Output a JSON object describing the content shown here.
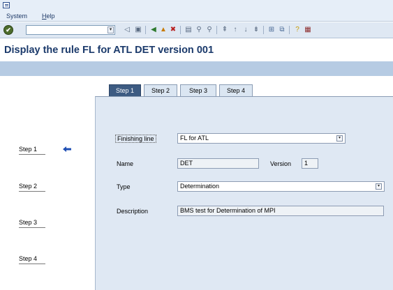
{
  "menu": {
    "items": [
      {
        "label": "System",
        "underline": ""
      },
      {
        "label": "elp",
        "underline": "H"
      }
    ]
  },
  "toolbar": {
    "enter_icon": "check-icon",
    "command_value": "",
    "icons": [
      "dropdown-icon",
      "back-small-icon",
      "save-icon",
      "back-icon",
      "exit-icon",
      "cancel-icon",
      "print-icon",
      "find-icon",
      "find-next-icon",
      "first-page-icon",
      "previous-page-icon",
      "next-page-icon",
      "last-page-icon",
      "create-session-icon",
      "shortcut-icon",
      "help-icon",
      "layout-icon"
    ]
  },
  "title": "Display the rule FL for ATL DET version 001",
  "steps_nav": [
    "Step 1",
    "Step 2",
    "Step 3",
    "Step 4"
  ],
  "current_step_indicator": "arrow-left-icon",
  "tabs": [
    {
      "label": "Step 1",
      "active": true
    },
    {
      "label": "Step 2",
      "active": false
    },
    {
      "label": "Step 3",
      "active": false
    },
    {
      "label": "Step 4",
      "active": false
    }
  ],
  "form": {
    "finishing_line": {
      "label": "Finishing line",
      "value": "FL for ATL"
    },
    "name": {
      "label": "Name",
      "value": "DET"
    },
    "version": {
      "label": "Version",
      "value": "1"
    },
    "type": {
      "label": "Type",
      "value": "Determination"
    },
    "description": {
      "label": "Description",
      "value": "BMS test for Determination of MPI"
    }
  },
  "colors": {
    "title": "#1b3a6b",
    "active_tab": "#3d5b82",
    "content_bg": "#dfe8f3",
    "app_toolbar": "#b6cbe3"
  }
}
